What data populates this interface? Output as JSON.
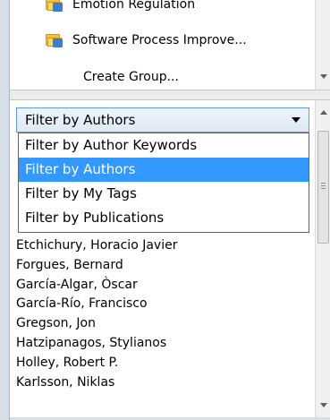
{
  "groups": {
    "items": [
      {
        "label": "Emotion Regulation",
        "icon": "folder-shared-icon"
      },
      {
        "label": "Software Process Improve...",
        "icon": "folder-shared-icon"
      }
    ],
    "create_group_label": "Create Group..."
  },
  "filter": {
    "selected": "Filter by Authors",
    "options": [
      "Filter by Author Keywords",
      "Filter by Authors",
      "Filter by My Tags",
      "Filter by Publications"
    ]
  },
  "authors": [
    "Etchichury, Horacio Javier",
    "Forgues, Bernard",
    "García-Algar, Òscar",
    "García-Río, Francisco",
    "Gregson, Jon",
    "Hatzipanagos, Stylianos",
    "Holley, Robert P.",
    "Karlsson, Niklas"
  ],
  "colors": {
    "selection": "#3399ff",
    "select_border": "#5d9ae0"
  }
}
